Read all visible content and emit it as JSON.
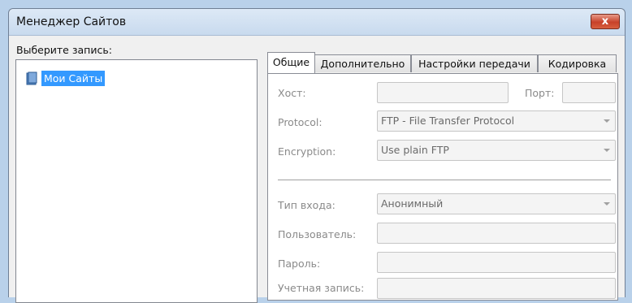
{
  "window": {
    "title": "Менеджер Сайтов",
    "close_label": "x"
  },
  "left": {
    "select_label": "Выберите запись:",
    "tree": [
      {
        "label": "Мои Сайты",
        "icon": "folder-icon",
        "selected": true
      }
    ]
  },
  "tabs": [
    {
      "label": "Общие",
      "active": true
    },
    {
      "label": "Дополнительно"
    },
    {
      "label": "Настройки передачи"
    },
    {
      "label": "Кодировка"
    }
  ],
  "general": {
    "host_label": "Хост:",
    "host_value": "",
    "port_label": "Порт:",
    "port_value": "",
    "protocol_label": "Protocol:",
    "protocol_value": "FTP - File Transfer Protocol",
    "encryption_label": "Encryption:",
    "encryption_value": "Use plain FTP",
    "logon_type_label": "Тип входа:",
    "logon_type_value": "Анонимный",
    "user_label": "Пользователь:",
    "user_value": "",
    "password_label": "Пароль:",
    "password_value": "",
    "account_label": "Учетная запись:",
    "account_value": ""
  },
  "colors": {
    "selection": "#3399ff",
    "close_button": "#c7412a"
  }
}
